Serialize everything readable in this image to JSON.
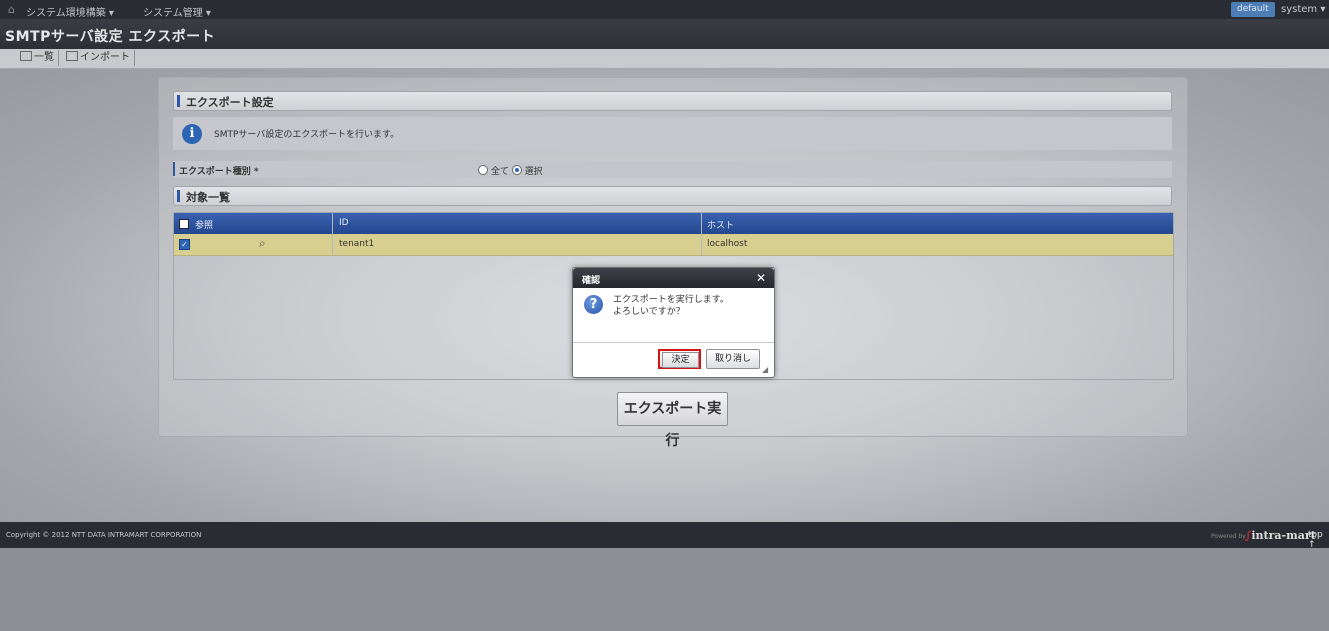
{
  "topbar": {
    "home_icon": "home-icon",
    "menu1": "システム環境構築 ▾",
    "menu2": "システム管理 ▾",
    "default_label": "default",
    "user": "system ▾"
  },
  "page": {
    "title": "SMTPサーバ設定 エクスポート"
  },
  "tabs": [
    {
      "label": "一覧",
      "icon": "list-icon"
    },
    {
      "label": "インポート",
      "icon": "import-icon"
    }
  ],
  "export_settings": {
    "heading": "エクスポート設定",
    "info_message": "SMTPサーバ設定のエクスポートを行います。",
    "type_label": "エクスポート種別 *",
    "option_all": "全て",
    "option_select": "選択",
    "selected_option": "選択"
  },
  "target_list": {
    "heading": "対象一覧",
    "columns": [
      "参照",
      "ID",
      "ホスト"
    ],
    "rows": [
      {
        "checked": true,
        "id": "tenant1",
        "host": "localhost"
      }
    ]
  },
  "execute_button": "エクスポート実行",
  "dialog": {
    "title": "確認",
    "line1": "エクスポートを実行します。",
    "line2": "よろしいですか？",
    "ok": "決定",
    "cancel": "取り消し"
  },
  "footer": {
    "copyright": "Copyright © 2012 NTT DATA INTRAMART CORPORATION",
    "powered": "Powered by",
    "logo": "intra-mart",
    "top": "top ↑"
  },
  "colors": {
    "accent": "#2d56a5",
    "highlight_row": "#d7cf8f",
    "dialog_ok_border": "#d41414"
  }
}
